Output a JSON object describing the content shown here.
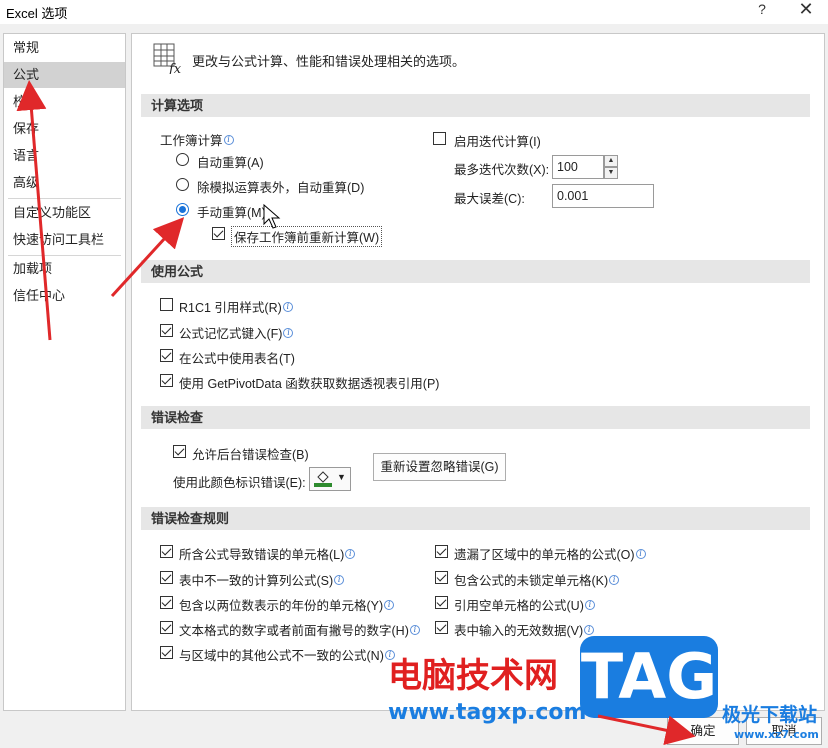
{
  "window": {
    "title": "Excel 选项",
    "help_glyph": "?",
    "close_glyph": "✕"
  },
  "sidebar": {
    "items": [
      {
        "label": "常规"
      },
      {
        "label": "公式",
        "active": true
      },
      {
        "label": "校对"
      },
      {
        "label": "保存"
      },
      {
        "label": "语言"
      },
      {
        "label": "高级"
      },
      {
        "label": "自定义功能区"
      },
      {
        "label": "快速访问工具栏"
      },
      {
        "label": "加载项"
      },
      {
        "label": "信任中心"
      }
    ]
  },
  "header": {
    "icon": "formula-fx-icon",
    "text": "更改与公式计算、性能和错误处理相关的选项。"
  },
  "calc": {
    "section_title": "计算选项",
    "workbook_label": "工作簿计算",
    "options": [
      {
        "label": "自动重算(A)",
        "selected": false
      },
      {
        "label": "除模拟运算表外，自动重算(D)",
        "selected": false
      },
      {
        "label": "手动重算(M)",
        "selected": true
      }
    ],
    "recalc_before_save": {
      "label": "保存工作簿前重新计算(W)",
      "checked": true
    },
    "iterative": {
      "label": "启用迭代计算(I)",
      "checked": false
    },
    "max_iter_label": "最多迭代次数(X):",
    "max_iter_value": "100",
    "max_change_label": "最大误差(C):",
    "max_change_value": "0.001"
  },
  "formulas": {
    "section_title": "使用公式",
    "items": [
      {
        "label": "R1C1 引用样式(R)",
        "checked": false,
        "info": true
      },
      {
        "label": "公式记忆式键入(F)",
        "checked": true,
        "info": true
      },
      {
        "label": "在公式中使用表名(T)",
        "checked": true,
        "info": false
      },
      {
        "label": "使用 GetPivotData 函数获取数据透视表引用(P)",
        "checked": true,
        "info": false
      }
    ]
  },
  "error_checking": {
    "section_title": "错误检查",
    "enable": {
      "label": "允许后台错误检查(B)",
      "checked": true
    },
    "color_label": "使用此颜色标识错误(E):",
    "reset_button": "重新设置忽略错误(G)",
    "swatch_color": "#2e8b2e"
  },
  "rules": {
    "section_title": "错误检查规则",
    "left": [
      {
        "label": "所含公式导致错误的单元格(L)",
        "checked": true
      },
      {
        "label": "表中不一致的计算列公式(S)",
        "checked": true
      },
      {
        "label": "包含以两位数表示的年份的单元格(Y)",
        "checked": true
      },
      {
        "label": "文本格式的数字或者前面有撇号的数字(H)",
        "checked": true
      },
      {
        "label": "与区域中的其他公式不一致的公式(N)",
        "checked": true
      }
    ],
    "right": [
      {
        "label": "遗漏了区域中的单元格的公式(O)",
        "checked": true
      },
      {
        "label": "包含公式的未锁定单元格(K)",
        "checked": true
      },
      {
        "label": "引用空单元格的公式(U)",
        "checked": true
      },
      {
        "label": "表中输入的无效数据(V)",
        "checked": true
      }
    ]
  },
  "footer": {
    "ok_label": "确定",
    "cancel_label": "取消"
  },
  "watermark": {
    "cn_text": "电脑技术网",
    "url_text": "www.tagxp.com",
    "tag_text": "TAG",
    "right_text": "极光下载站",
    "right_url": "www.xz7.com"
  },
  "colors": {
    "accent": "#1a73d9",
    "annotation_arrow": "#e0282a",
    "watermark_red": "#e02020",
    "watermark_blue": "#1a7de0"
  }
}
